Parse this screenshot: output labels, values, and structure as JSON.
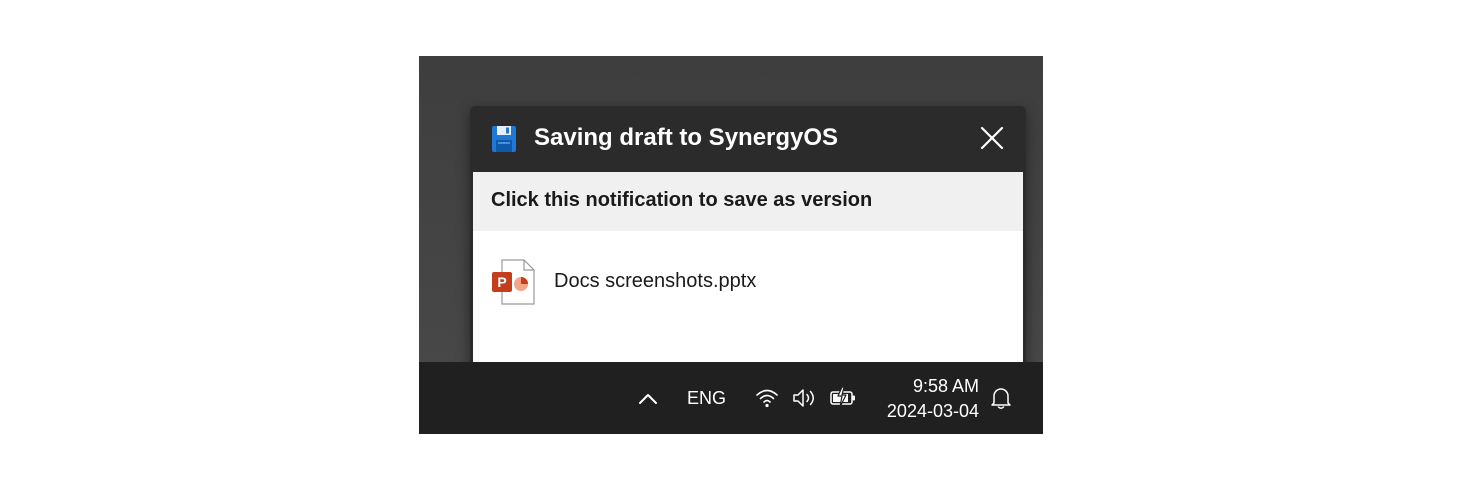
{
  "notification": {
    "title": "Saving draft to SynergyOS",
    "title_icon": "floppy-disk-icon",
    "close_icon": "close-icon",
    "subtitle": "Click this notification to save as version",
    "file": {
      "name": "Docs screenshots.pptx",
      "icon": "powerpoint-file-icon",
      "icon_letter": "P"
    }
  },
  "taskbar": {
    "overflow_icon": "chevron-up-icon",
    "language": "ENG",
    "wifi_icon": "wifi-icon",
    "volume_icon": "volume-icon",
    "battery_icon": "battery-charging-icon",
    "time": "9:58 AM",
    "date": "2024-03-04",
    "notification_icon": "bell-icon"
  },
  "colors": {
    "header_bg": "#2b2b2b",
    "taskbar_bg": "#202020",
    "subheader_bg": "#f0f0f0",
    "powerpoint_red": "#c43e1c",
    "floppy_blue": "#1e78d4"
  }
}
